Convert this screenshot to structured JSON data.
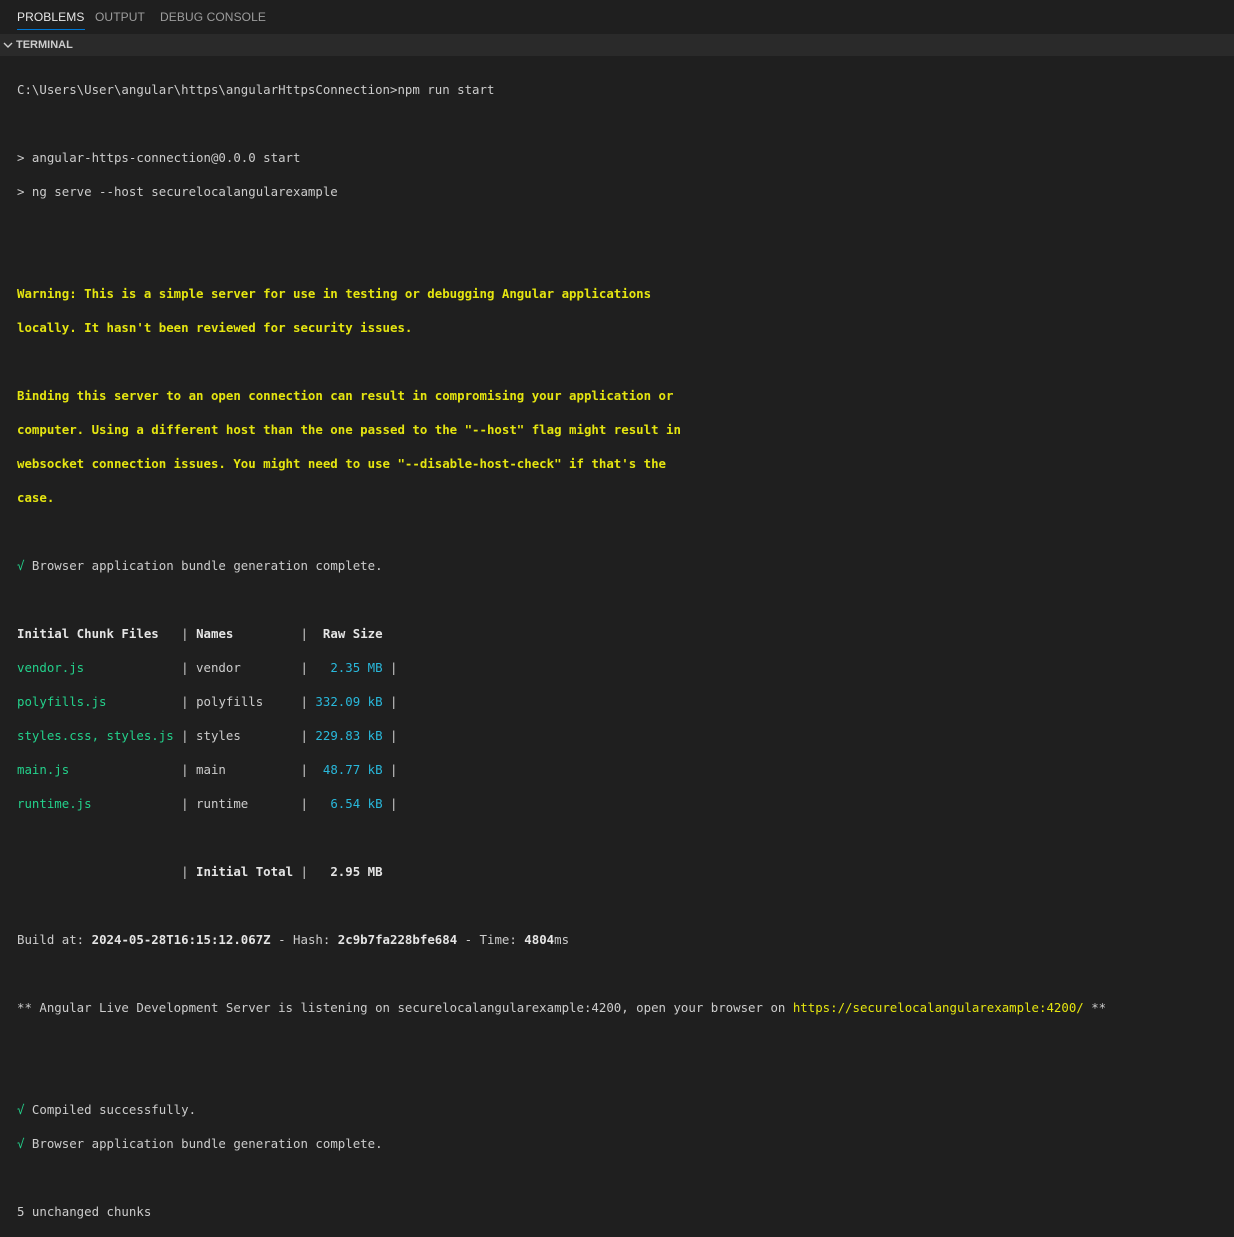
{
  "tabs": [
    "PROBLEMS",
    "OUTPUT",
    "DEBUG CONSOLE"
  ],
  "section_title": "TERMINAL",
  "terminal": {
    "prompt": "C:\\Users\\User\\angular\\https\\angularHttpsConnection>npm run start",
    "npm1": "> angular-https-connection@0.0.0 start",
    "npm2": "> ng serve --host securelocalangularexample",
    "warning": [
      "Warning: This is a simple server for use in testing or debugging Angular applications",
      "locally. It hasn't been reviewed for security issues.",
      "",
      "Binding this server to an open connection can result in compromising your application or",
      "computer. Using a different host than the one passed to the \"--host\" flag might result in",
      "websocket connection issues. You might need to use \"--disable-host-check\" if that's the",
      "case."
    ],
    "check_mark": "√",
    "bundle_complete": " Browser application bundle generation complete.",
    "table_header": {
      "files": "Initial Chunk Files",
      "names": "Names",
      "size": "Raw Size"
    },
    "rows": [
      {
        "file": "vendor.js",
        "name": "vendor",
        "size": "2.35 MB"
      },
      {
        "file": "polyfills.js",
        "name": "polyfills",
        "size": "332.09 kB"
      },
      {
        "file": "styles.css, styles.js",
        "name": "styles",
        "size": "229.83 kB"
      },
      {
        "file": "main.js",
        "name": "main",
        "size": "48.77 kB"
      },
      {
        "file": "runtime.js",
        "name": "runtime",
        "size": "6.54 kB"
      }
    ],
    "total_label": "Initial Total",
    "total_size": "2.95 MB",
    "build_at_label": "Build at: ",
    "build_at": "2024-05-28T16:15:12.067Z",
    "hash_label": " - Hash: ",
    "hash": "2c9b7fa228bfe684",
    "time_label": " - Time: ",
    "time": "4804",
    "time_unit": "ms",
    "server_prefix": "** Angular Live Development Server is listening on securelocalangularexample:4200, open your browser on ",
    "server_url": "https://securelocalangularexample:4200/",
    "server_suffix": " **",
    "compiled": " Compiled successfully.",
    "bundle_complete2": " Browser application bundle generation complete.",
    "unchanged": "5 unchanged chunks"
  },
  "colors": {
    "yellow": "#e5e510",
    "green": "#23d18b",
    "blue": "#29b8db",
    "background": "#1f1f1f"
  }
}
